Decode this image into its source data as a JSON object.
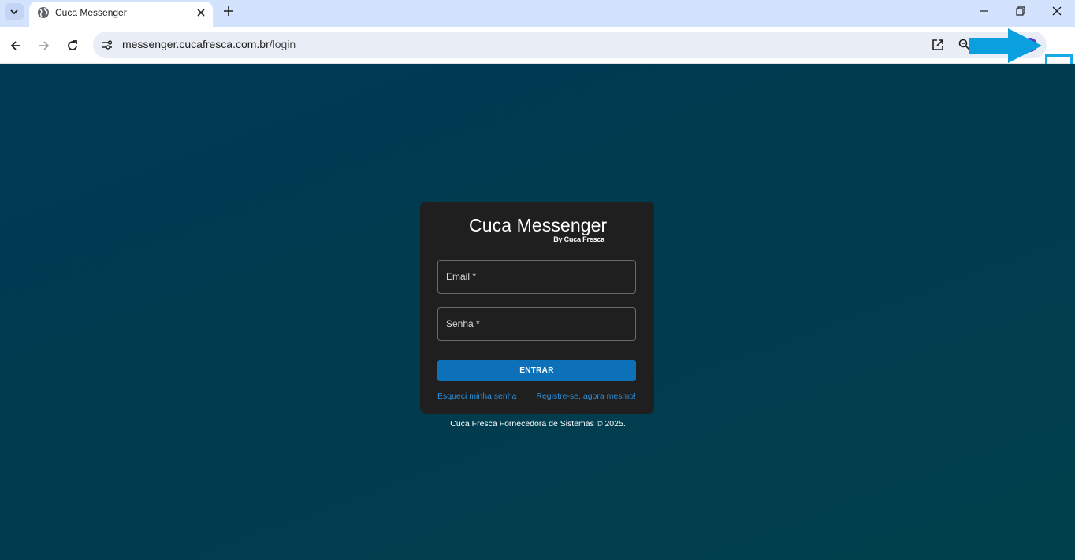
{
  "browser": {
    "tab_title": "Cuca Messenger",
    "url_host": "messenger.cucafresca.com.br",
    "url_path": "/login"
  },
  "login": {
    "brand_title": "Cuca Messenger",
    "brand_subtitle": "By Cuca Fresca",
    "email_label": "Email *",
    "password_label": "Senha *",
    "submit_label": "ENTRAR",
    "forgot_link": "Esqueci minha senha",
    "register_link": "Registre-se, agora mesmo!"
  },
  "footer": {
    "text": "Cuca Fresca Fornecedora de Sistemas © 2025."
  },
  "colors": {
    "primary_button": "#0d71b9",
    "link": "#2b8fd8",
    "card_bg": "#1f1f1f",
    "annotation": "#17a8e6"
  }
}
